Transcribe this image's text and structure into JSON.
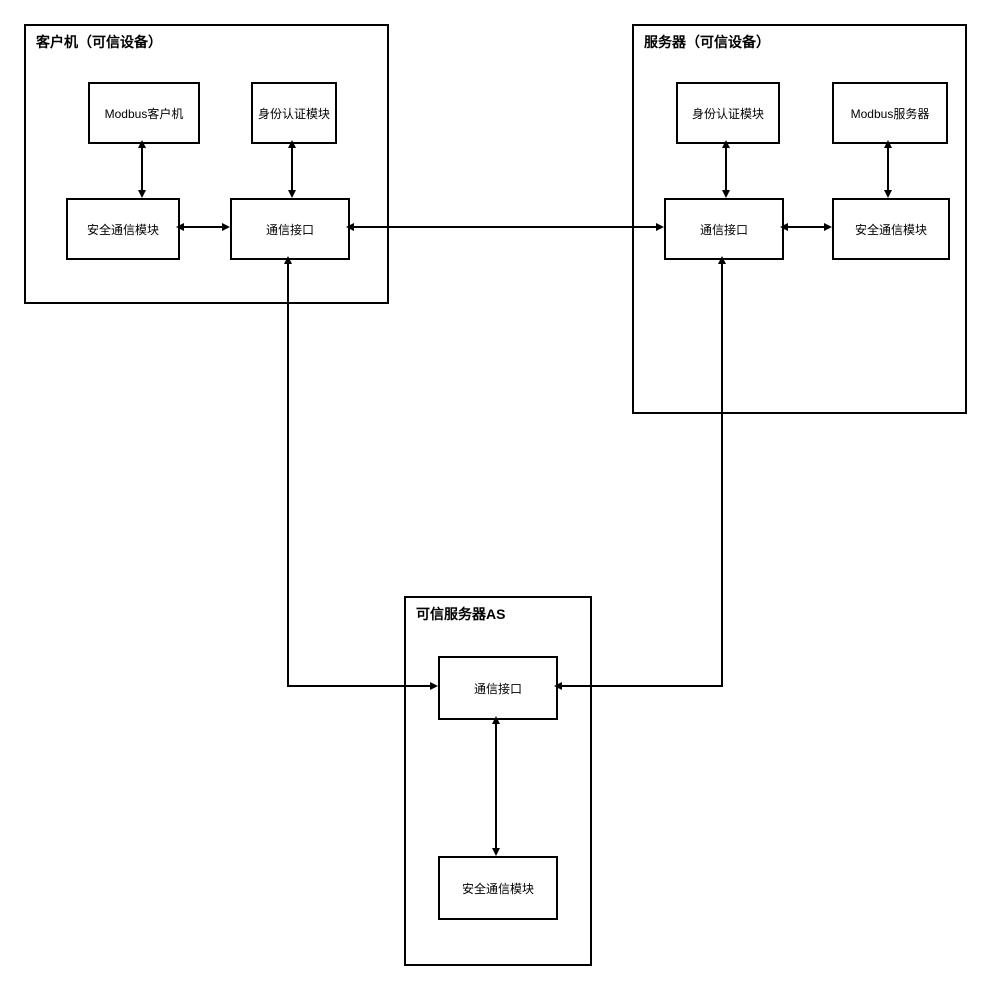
{
  "client": {
    "title": "客户机（可信设备）",
    "modbus_client": "Modbus客户机",
    "auth_module": "身份认证模块",
    "secure_comm": "安全通信模块",
    "comm_interface": "通信接口"
  },
  "server": {
    "title": "服务器（可信设备）",
    "auth_module": "身份认证模块",
    "modbus_server": "Modbus服务器",
    "comm_interface": "通信接口",
    "secure_comm": "安全通信模块"
  },
  "trusted_as": {
    "title": "可信服务器AS",
    "comm_interface": "通信接口",
    "secure_comm": "安全通信模块"
  }
}
